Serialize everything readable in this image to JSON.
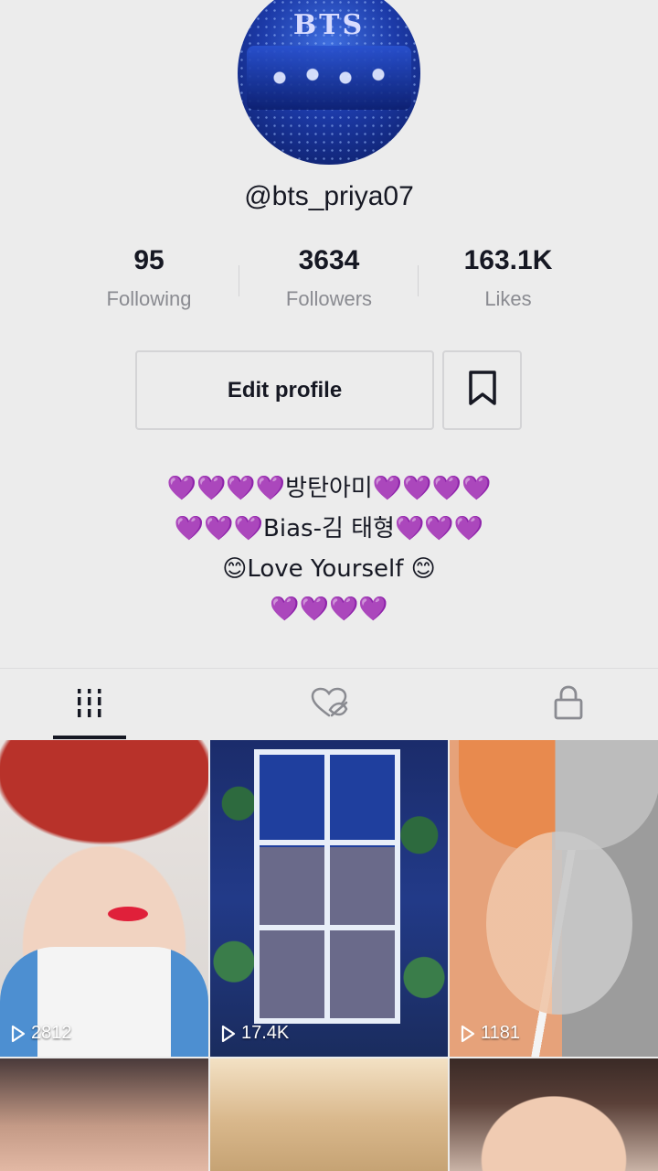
{
  "profile": {
    "username": "@bts_priya07",
    "avatar_text": "BTS"
  },
  "stats": [
    {
      "value": "95",
      "label": "Following"
    },
    {
      "value": "3634",
      "label": "Followers"
    },
    {
      "value": "163.1K",
      "label": "Likes"
    }
  ],
  "actions": {
    "edit_label": "Edit profile",
    "bookmark_icon": "bookmark-icon"
  },
  "bio": [
    "💜💜💜💜방탄아미💜💜💜💜",
    "💜💜💜Bias-김 태형💜💜💜",
    "😊Love Yourself 😊",
    "💜💜💜💜"
  ],
  "tabs": [
    {
      "icon": "grid-icon",
      "active": true
    },
    {
      "icon": "liked-hidden-icon",
      "active": false
    },
    {
      "icon": "lock-icon",
      "active": false
    }
  ],
  "videos": [
    {
      "views": "2812"
    },
    {
      "views": "17.4K"
    },
    {
      "views": "1181"
    }
  ],
  "colors": {
    "background": "#ececec",
    "text": "#161823",
    "muted": "#8a8b91",
    "accent_purple": "#8e2fc8"
  }
}
